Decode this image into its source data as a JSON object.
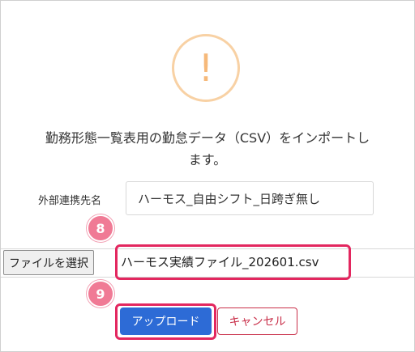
{
  "dialog": {
    "icon_glyph": "!",
    "icon_name": "warning-icon",
    "icon_color": "#f6b97a",
    "message": "勤務形態一覧表用の勤怠データ（CSV）をインポートし\nます。"
  },
  "form": {
    "external_link_label": "外部連携先名",
    "external_link_value": "ハーモス_自由シフト_日跨ぎ無し",
    "file_button_label": "ファイルを選択",
    "file_name": "ハーモス実績ファイル_202601.csv"
  },
  "annotations": {
    "step_file": "8",
    "step_upload": "9",
    "highlight_color": "#e3275f"
  },
  "actions": {
    "upload_label": "アップロード",
    "cancel_label": "キャンセル",
    "upload_color": "#2d6bd6",
    "cancel_color": "#c9304a"
  }
}
